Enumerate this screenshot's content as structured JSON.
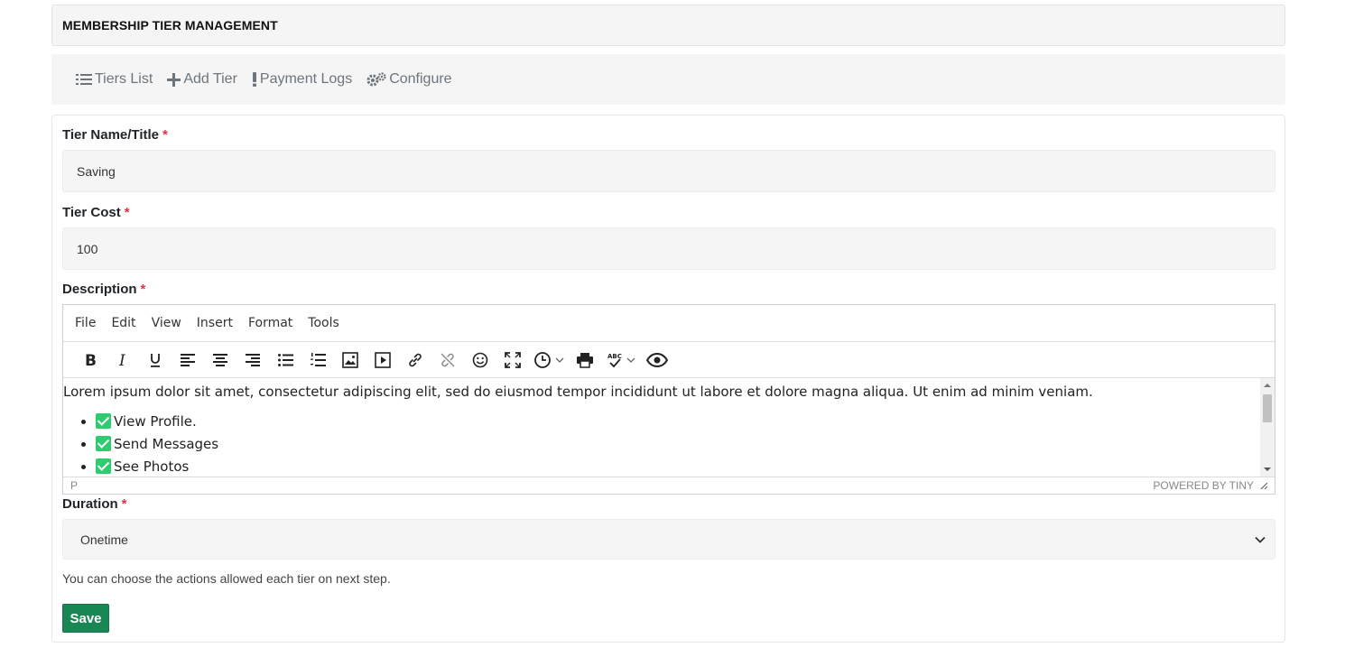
{
  "header": {
    "title": "MEMBERSHIP TIER MANAGEMENT"
  },
  "nav": {
    "items": [
      {
        "label": "Tiers List",
        "icon": "list-icon"
      },
      {
        "label": "Add Tier",
        "icon": "plus-icon"
      },
      {
        "label": "Payment Logs",
        "icon": "exclamation-icon"
      },
      {
        "label": "Configure",
        "icon": "gears-icon"
      }
    ]
  },
  "form": {
    "tier_name": {
      "label": "Tier Name/Title",
      "required_mark": "*",
      "value": "Saving"
    },
    "tier_cost": {
      "label": "Tier Cost",
      "required_mark": "*",
      "value": "100"
    },
    "description": {
      "label": "Description",
      "required_mark": "*"
    },
    "duration": {
      "label": "Duration",
      "required_mark": "*",
      "selected": "Onetime"
    },
    "help_text": "You can choose the actions allowed each tier on next step.",
    "save_label": "Save"
  },
  "editor": {
    "menu": [
      "File",
      "Edit",
      "View",
      "Insert",
      "Format",
      "Tools"
    ],
    "content_text": "Lorem ipsum dolor sit amet, consectetur adipiscing elit, sed do eiusmod tempor incididunt ut labore et dolore magna aliqua. Ut enim ad minim veniam.",
    "list_items": [
      "View Profile.",
      "Send Messages",
      "See Photos"
    ],
    "status_path": "P",
    "powered_by": "POWERED BY TINY"
  },
  "colors": {
    "save_button": "#198754",
    "required": "#dc3545",
    "check": "#2ecc71"
  }
}
